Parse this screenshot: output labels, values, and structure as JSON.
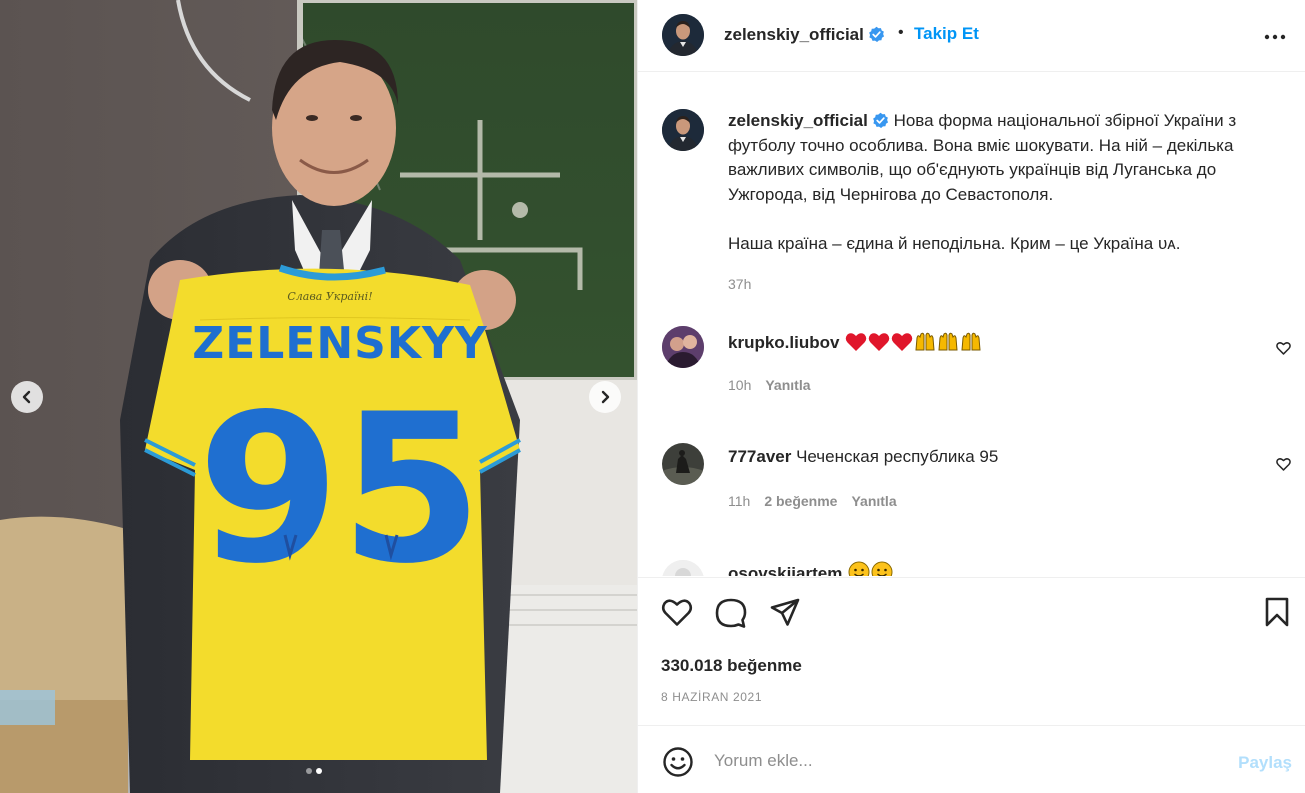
{
  "post": {
    "username": "zelenskiy_official",
    "follow_label": "Takip Et",
    "separator": "•"
  },
  "caption": {
    "username": "zelenskiy_official",
    "line1": "Нова форма національної збірної України з футболу точно особлива. Вона вміє шокувати. На ній – декілька важливих символів, що об'єднують українців від Луганська до Ужгорода, від Чернігова до Севастополя.",
    "line2": "Наша країна – єдина й неподільна. Крим – це Україна ᴜᴀ.",
    "time": "37h"
  },
  "comments": [
    {
      "username": "krupko.liubov",
      "text": "",
      "emoji": [
        "red-heart",
        "red-heart",
        "red-heart",
        "raising-hands",
        "raising-hands",
        "raising-hands"
      ],
      "time": "10h",
      "likes": "",
      "reply_label": "Yanıtla"
    },
    {
      "username": "777aver",
      "text": "Чеченская республика 95",
      "time": "11h",
      "likes": "2 beğenme",
      "reply_label": "Yanıtla"
    },
    {
      "username": "osovskiiartem",
      "text": "",
      "emoji": [
        "smiley",
        "smiley"
      ]
    }
  ],
  "photo": {
    "jersey_name": "ZELENSKYY",
    "jersey_number": "95",
    "collar_text": "Слава Україні!",
    "slide_count": 2,
    "active_slide": 2
  },
  "stats": {
    "likes": "330.018 beğenme",
    "date": "8 HAZİRAN 2021"
  },
  "comment_box": {
    "placeholder": "Yorum ekle...",
    "share_label": "Paylaş"
  },
  "colors": {
    "accent": "#0095f6",
    "jersey_yellow": "#f3dc2c",
    "jersey_blue": "#1f6fd0",
    "verified": "#3897f0"
  }
}
